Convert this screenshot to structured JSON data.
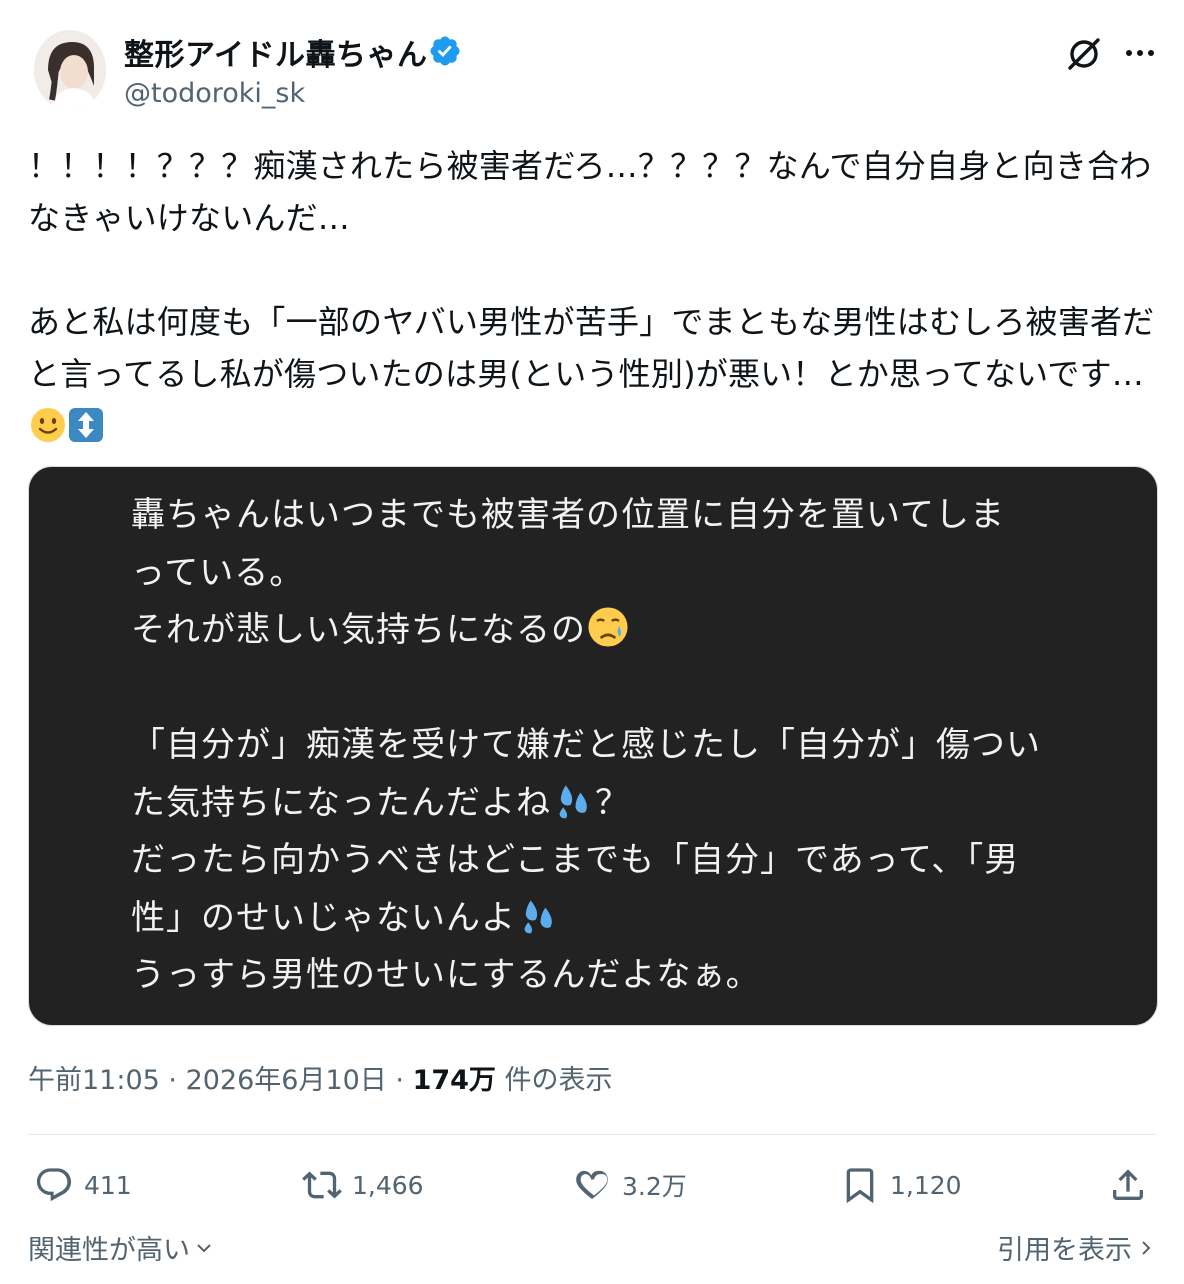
{
  "author": {
    "display_name": "整形アイドル轟ちゃん",
    "handle": "@todoroki_sk",
    "verified": true
  },
  "tweet": {
    "text_part1": "！！！！？？？痴漢されたら被害者だろ…？？？？なんで自分自身と向き合わなきゃいけないんだ…\n\nあと私は何度も「一部のヤバい男性が苦手」でまともな男性はむしろ被害者だと言ってるし私が傷ついたのは男(という性別)が悪い！とか思ってないです…",
    "emojis": [
      "slightly-smiling-face",
      "up-down-arrow"
    ]
  },
  "media": {
    "line1": "轟ちゃんはいつまでも被害者の位置に自分を置いてしま\nっている。\nそれが悲しい気持ちになるの",
    "line2": "\n\n「自分が」痴漢を受けて嫌だと感じたし「自分が」傷つい\nた気持ちになったんだよね",
    "line3": "？\nだったら向かうべきはどこまでも「自分」であって、「男\n性」のせいじゃないんよ",
    "line4": "\nうっすら男性のせいにするんだよなぁ。",
    "background": "#222222",
    "text_color": "#f2f2f2"
  },
  "meta": {
    "time": "午前11:05",
    "separator1": " · ",
    "date": "2026年6月10日",
    "separator2": " · ",
    "views": "174万",
    "views_label": " 件の表示"
  },
  "actions": {
    "replies": "411",
    "retweets": "1,466",
    "likes": "3.2万",
    "bookmarks": "1,120"
  },
  "footer": {
    "sort_label": "関連性が高い",
    "quotes_label": "引用を表示"
  },
  "colors": {
    "text": "#0f1419",
    "secondary": "#536471",
    "verified_blue": "#1d9bf0",
    "divider": "#e6e9ec"
  }
}
